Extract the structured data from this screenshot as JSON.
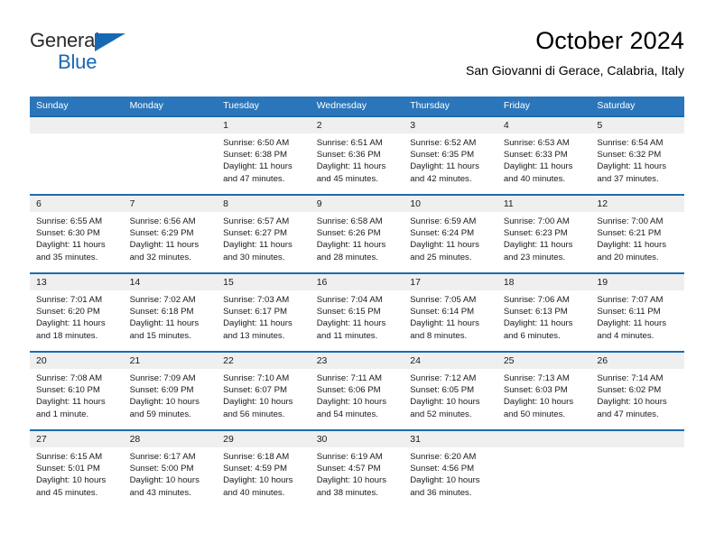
{
  "brand": {
    "name_part1": "General",
    "name_part2": "Blue",
    "accent_color": "#1668b3",
    "triangle_icon": "triangle-icon"
  },
  "header": {
    "title": "October 2024",
    "subtitle": "San Giovanni di Gerace, Calabria, Italy"
  },
  "calendar": {
    "header_bg": "#2b76ba",
    "row_divider_color": "#1b6cb0",
    "daynum_band_bg": "#efefef",
    "columns": [
      "Sunday",
      "Monday",
      "Tuesday",
      "Wednesday",
      "Thursday",
      "Friday",
      "Saturday"
    ],
    "weeks": [
      [
        {
          "day": ""
        },
        {
          "day": ""
        },
        {
          "day": "1",
          "sunrise": "Sunrise: 6:50 AM",
          "sunset": "Sunset: 6:38 PM",
          "daylight_1": "Daylight: 11 hours",
          "daylight_2": "and 47 minutes."
        },
        {
          "day": "2",
          "sunrise": "Sunrise: 6:51 AM",
          "sunset": "Sunset: 6:36 PM",
          "daylight_1": "Daylight: 11 hours",
          "daylight_2": "and 45 minutes."
        },
        {
          "day": "3",
          "sunrise": "Sunrise: 6:52 AM",
          "sunset": "Sunset: 6:35 PM",
          "daylight_1": "Daylight: 11 hours",
          "daylight_2": "and 42 minutes."
        },
        {
          "day": "4",
          "sunrise": "Sunrise: 6:53 AM",
          "sunset": "Sunset: 6:33 PM",
          "daylight_1": "Daylight: 11 hours",
          "daylight_2": "and 40 minutes."
        },
        {
          "day": "5",
          "sunrise": "Sunrise: 6:54 AM",
          "sunset": "Sunset: 6:32 PM",
          "daylight_1": "Daylight: 11 hours",
          "daylight_2": "and 37 minutes."
        }
      ],
      [
        {
          "day": "6",
          "sunrise": "Sunrise: 6:55 AM",
          "sunset": "Sunset: 6:30 PM",
          "daylight_1": "Daylight: 11 hours",
          "daylight_2": "and 35 minutes."
        },
        {
          "day": "7",
          "sunrise": "Sunrise: 6:56 AM",
          "sunset": "Sunset: 6:29 PM",
          "daylight_1": "Daylight: 11 hours",
          "daylight_2": "and 32 minutes."
        },
        {
          "day": "8",
          "sunrise": "Sunrise: 6:57 AM",
          "sunset": "Sunset: 6:27 PM",
          "daylight_1": "Daylight: 11 hours",
          "daylight_2": "and 30 minutes."
        },
        {
          "day": "9",
          "sunrise": "Sunrise: 6:58 AM",
          "sunset": "Sunset: 6:26 PM",
          "daylight_1": "Daylight: 11 hours",
          "daylight_2": "and 28 minutes."
        },
        {
          "day": "10",
          "sunrise": "Sunrise: 6:59 AM",
          "sunset": "Sunset: 6:24 PM",
          "daylight_1": "Daylight: 11 hours",
          "daylight_2": "and 25 minutes."
        },
        {
          "day": "11",
          "sunrise": "Sunrise: 7:00 AM",
          "sunset": "Sunset: 6:23 PM",
          "daylight_1": "Daylight: 11 hours",
          "daylight_2": "and 23 minutes."
        },
        {
          "day": "12",
          "sunrise": "Sunrise: 7:00 AM",
          "sunset": "Sunset: 6:21 PM",
          "daylight_1": "Daylight: 11 hours",
          "daylight_2": "and 20 minutes."
        }
      ],
      [
        {
          "day": "13",
          "sunrise": "Sunrise: 7:01 AM",
          "sunset": "Sunset: 6:20 PM",
          "daylight_1": "Daylight: 11 hours",
          "daylight_2": "and 18 minutes."
        },
        {
          "day": "14",
          "sunrise": "Sunrise: 7:02 AM",
          "sunset": "Sunset: 6:18 PM",
          "daylight_1": "Daylight: 11 hours",
          "daylight_2": "and 15 minutes."
        },
        {
          "day": "15",
          "sunrise": "Sunrise: 7:03 AM",
          "sunset": "Sunset: 6:17 PM",
          "daylight_1": "Daylight: 11 hours",
          "daylight_2": "and 13 minutes."
        },
        {
          "day": "16",
          "sunrise": "Sunrise: 7:04 AM",
          "sunset": "Sunset: 6:15 PM",
          "daylight_1": "Daylight: 11 hours",
          "daylight_2": "and 11 minutes."
        },
        {
          "day": "17",
          "sunrise": "Sunrise: 7:05 AM",
          "sunset": "Sunset: 6:14 PM",
          "daylight_1": "Daylight: 11 hours",
          "daylight_2": "and 8 minutes."
        },
        {
          "day": "18",
          "sunrise": "Sunrise: 7:06 AM",
          "sunset": "Sunset: 6:13 PM",
          "daylight_1": "Daylight: 11 hours",
          "daylight_2": "and 6 minutes."
        },
        {
          "day": "19",
          "sunrise": "Sunrise: 7:07 AM",
          "sunset": "Sunset: 6:11 PM",
          "daylight_1": "Daylight: 11 hours",
          "daylight_2": "and 4 minutes."
        }
      ],
      [
        {
          "day": "20",
          "sunrise": "Sunrise: 7:08 AM",
          "sunset": "Sunset: 6:10 PM",
          "daylight_1": "Daylight: 11 hours",
          "daylight_2": "and 1 minute."
        },
        {
          "day": "21",
          "sunrise": "Sunrise: 7:09 AM",
          "sunset": "Sunset: 6:09 PM",
          "daylight_1": "Daylight: 10 hours",
          "daylight_2": "and 59 minutes."
        },
        {
          "day": "22",
          "sunrise": "Sunrise: 7:10 AM",
          "sunset": "Sunset: 6:07 PM",
          "daylight_1": "Daylight: 10 hours",
          "daylight_2": "and 56 minutes."
        },
        {
          "day": "23",
          "sunrise": "Sunrise: 7:11 AM",
          "sunset": "Sunset: 6:06 PM",
          "daylight_1": "Daylight: 10 hours",
          "daylight_2": "and 54 minutes."
        },
        {
          "day": "24",
          "sunrise": "Sunrise: 7:12 AM",
          "sunset": "Sunset: 6:05 PM",
          "daylight_1": "Daylight: 10 hours",
          "daylight_2": "and 52 minutes."
        },
        {
          "day": "25",
          "sunrise": "Sunrise: 7:13 AM",
          "sunset": "Sunset: 6:03 PM",
          "daylight_1": "Daylight: 10 hours",
          "daylight_2": "and 50 minutes."
        },
        {
          "day": "26",
          "sunrise": "Sunrise: 7:14 AM",
          "sunset": "Sunset: 6:02 PM",
          "daylight_1": "Daylight: 10 hours",
          "daylight_2": "and 47 minutes."
        }
      ],
      [
        {
          "day": "27",
          "sunrise": "Sunrise: 6:15 AM",
          "sunset": "Sunset: 5:01 PM",
          "daylight_1": "Daylight: 10 hours",
          "daylight_2": "and 45 minutes."
        },
        {
          "day": "28",
          "sunrise": "Sunrise: 6:17 AM",
          "sunset": "Sunset: 5:00 PM",
          "daylight_1": "Daylight: 10 hours",
          "daylight_2": "and 43 minutes."
        },
        {
          "day": "29",
          "sunrise": "Sunrise: 6:18 AM",
          "sunset": "Sunset: 4:59 PM",
          "daylight_1": "Daylight: 10 hours",
          "daylight_2": "and 40 minutes."
        },
        {
          "day": "30",
          "sunrise": "Sunrise: 6:19 AM",
          "sunset": "Sunset: 4:57 PM",
          "daylight_1": "Daylight: 10 hours",
          "daylight_2": "and 38 minutes."
        },
        {
          "day": "31",
          "sunrise": "Sunrise: 6:20 AM",
          "sunset": "Sunset: 4:56 PM",
          "daylight_1": "Daylight: 10 hours",
          "daylight_2": "and 36 minutes."
        },
        {
          "day": ""
        },
        {
          "day": ""
        }
      ]
    ]
  }
}
